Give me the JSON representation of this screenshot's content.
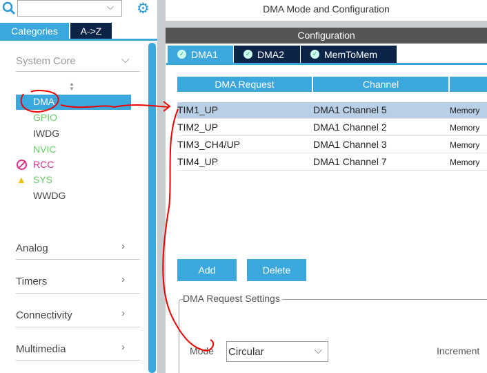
{
  "left": {
    "search": {
      "value": "",
      "placeholder": ""
    },
    "tabs": [
      "Categories",
      "A->Z"
    ],
    "system_core": "System Core",
    "items": [
      {
        "label": "DMA",
        "color": "#ffffff",
        "status": ""
      },
      {
        "label": "GPIO",
        "color": "#5cb85c",
        "status": ""
      },
      {
        "label": "IWDG",
        "color": "#444444",
        "status": ""
      },
      {
        "label": "NVIC",
        "color": "#5cb85c",
        "status": ""
      },
      {
        "label": "RCC",
        "color": "#e0308a",
        "status": "error"
      },
      {
        "label": "SYS",
        "color": "#5cb85c",
        "status": "warning"
      },
      {
        "label": "WWDG",
        "color": "#444444",
        "status": ""
      }
    ],
    "categories": [
      "Analog",
      "Timers",
      "Connectivity",
      "Multimedia"
    ]
  },
  "right": {
    "title": "DMA Mode and Configuration",
    "config_title": "Configuration",
    "tabs": [
      "DMA1",
      "DMA2",
      "MemToMem"
    ],
    "table": {
      "headers": [
        "DMA Request",
        "Channel",
        ""
      ],
      "rows": [
        [
          "TIM1_UP",
          "DMA1 Channel 5",
          "Memory"
        ],
        [
          "TIM2_UP",
          "DMA1 Channel 2",
          "Memory"
        ],
        [
          "TIM3_CH4/UP",
          "DMA1 Channel 3",
          "Memory"
        ],
        [
          "TIM4_UP",
          "DMA1 Channel 7",
          "Memory"
        ]
      ]
    },
    "add": "Add",
    "delete": "Delete",
    "settings_title": "DMA Request Settings",
    "mode_label": "Mode",
    "mode_value": "Circular",
    "increment_label": "Increment"
  },
  "colors": {
    "accent": "#3aa8dc",
    "navy": "#0b2447",
    "selected_row": "#b8cfe5"
  }
}
